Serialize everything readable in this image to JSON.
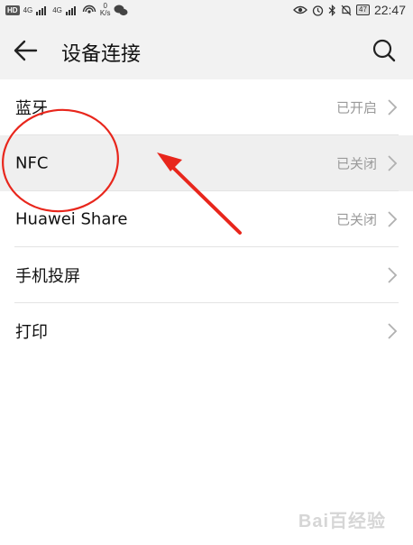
{
  "status_bar": {
    "hd_label": "HD",
    "signal1_label": "4G",
    "signal2_label": "4G",
    "speed_value": "0",
    "speed_unit": "K/s",
    "battery": "47",
    "time": "22:47"
  },
  "header": {
    "title": "设备连接"
  },
  "items": [
    {
      "label": "蓝牙",
      "status": "已开启"
    },
    {
      "label": "NFC",
      "status": "已关闭"
    },
    {
      "label": "Huawei Share",
      "status": "已关闭"
    },
    {
      "label": "手机投屏",
      "status": ""
    },
    {
      "label": "打印",
      "status": ""
    }
  ],
  "colors": {
    "annotation": "#e8261c",
    "status_text": "#9a9a9a",
    "highlight_row": "#efefef"
  },
  "watermark": "Bai百经验"
}
